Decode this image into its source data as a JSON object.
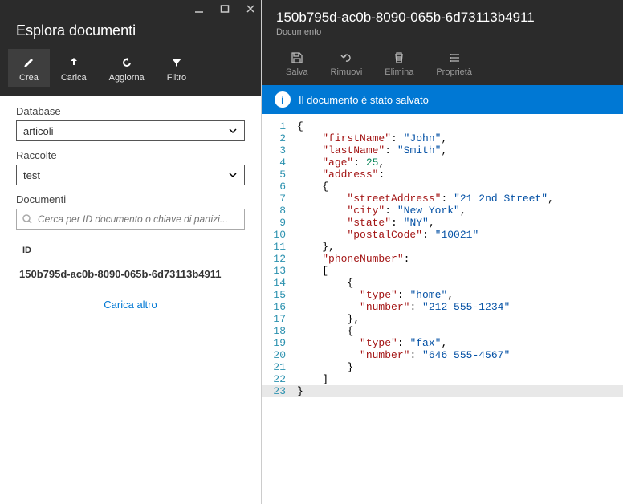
{
  "left": {
    "title": "Esplora documenti",
    "toolbar": {
      "create": "Crea",
      "load": "Carica",
      "refresh": "Aggiorna",
      "filter": "Filtro"
    },
    "database_label": "Database",
    "database_value": "articoli",
    "collections_label": "Raccolte",
    "collections_value": "test",
    "documents_label": "Documenti",
    "search_placeholder": "Cerca per ID documento o chiave di partizi...",
    "id_header": "ID",
    "doc_id": "150b795d-ac0b-8090-065b-6d73113b4911",
    "load_more": "Carica altro"
  },
  "right": {
    "title": "150b795d-ac0b-8090-065b-6d73113b4911",
    "subtitle": "Documento",
    "toolbar": {
      "save": "Salva",
      "remove": "Rimuovi",
      "delete": "Elimina",
      "properties": "Proprietà"
    },
    "notification": "Il documento è stato salvato"
  },
  "code": {
    "l1": "{",
    "l2a": "\"firstName\"",
    "l2b": "\"John\"",
    "l3a": "\"lastName\"",
    "l3b": "\"Smith\"",
    "l4a": "\"age\"",
    "l4b": "25",
    "l5a": "\"address\"",
    "l6": "{",
    "l7a": "\"streetAddress\"",
    "l7b": "\"21 2nd Street\"",
    "l8a": "\"city\"",
    "l8b": "\"New York\"",
    "l9a": "\"state\"",
    "l9b": "\"NY\"",
    "l10a": "\"postalCode\"",
    "l10b": "\"10021\"",
    "l11": "},",
    "l12a": "\"phoneNumber\"",
    "l13": "[",
    "l14": "{",
    "l15a": "\"type\"",
    "l15b": "\"home\"",
    "l16a": "\"number\"",
    "l16b": "\"212 555-1234\"",
    "l17": "},",
    "l18": "{",
    "l19a": "\"type\"",
    "l19b": "\"fax\"",
    "l20a": "\"number\"",
    "l20b": "\"646 555-4567\"",
    "l21": "}",
    "l22": "]",
    "l23": "}"
  }
}
